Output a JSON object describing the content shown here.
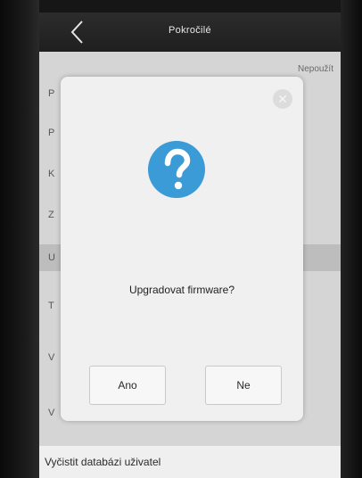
{
  "header": {
    "title": "Pokročilé",
    "back_icon": "chevron-left-icon"
  },
  "toolbar": {
    "apply_label": "Nepoužít"
  },
  "menu": {
    "rows": [
      {
        "label": "P"
      },
      {
        "label": "P"
      },
      {
        "label": "K"
      },
      {
        "label": "Z"
      },
      {
        "label": "U"
      },
      {
        "label": "T"
      },
      {
        "label": "V"
      },
      {
        "label": "V"
      }
    ],
    "clear_db_label": "Vyčistit databázi uživatel"
  },
  "dialog": {
    "close_icon": "close-icon",
    "icon": "question-icon",
    "icon_color": "#3a9bd7",
    "message": "Upgradovat firmware?",
    "yes_label": "Ano",
    "no_label": "Ne"
  }
}
